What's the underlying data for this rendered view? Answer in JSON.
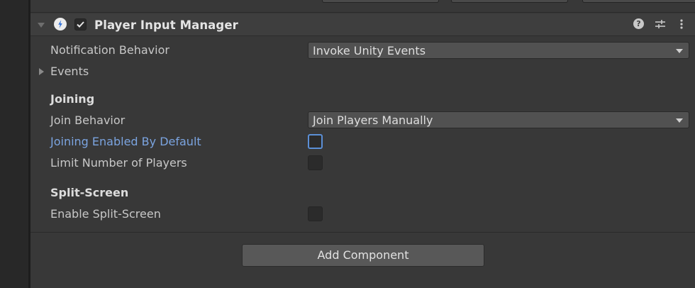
{
  "component": {
    "title": "Player Input Manager",
    "enabled": true,
    "icons": [
      "help-icon",
      "presets-icon",
      "context-menu-icon"
    ]
  },
  "fields": {
    "notification_behavior": {
      "label": "Notification Behavior",
      "value": "Invoke Unity Events"
    },
    "events": {
      "label": "Events"
    },
    "joining_section": "Joining",
    "join_behavior": {
      "label": "Join Behavior",
      "value": "Join Players Manually"
    },
    "joining_enabled_by_default": {
      "label": "Joining Enabled By Default",
      "checked": false
    },
    "limit_number_of_players": {
      "label": "Limit Number of Players",
      "checked": false
    },
    "split_screen_section": "Split-Screen",
    "enable_split_screen": {
      "label": "Enable Split-Screen",
      "checked": false
    }
  },
  "add_component": {
    "label": "Add Component"
  },
  "colors": {
    "panel_bg": "#383838",
    "header_bg": "#3e3e3e",
    "field_bg": "#515151",
    "focus_blue": "#7ba4e0"
  }
}
